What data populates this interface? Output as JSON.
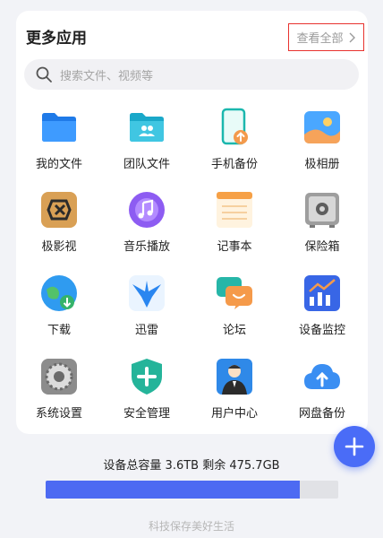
{
  "header": {
    "title": "更多应用",
    "view_all_label": "查看全部"
  },
  "search": {
    "placeholder": "搜索文件、视频等"
  },
  "apps": [
    {
      "label": "我的文件",
      "icon": "folder-icon"
    },
    {
      "label": "团队文件",
      "icon": "team-folder-icon"
    },
    {
      "label": "手机备份",
      "icon": "phone-backup-icon"
    },
    {
      "label": "极相册",
      "icon": "photo-album-icon"
    },
    {
      "label": "极影视",
      "icon": "video-icon"
    },
    {
      "label": "音乐播放",
      "icon": "music-icon"
    },
    {
      "label": "记事本",
      "icon": "notepad-icon"
    },
    {
      "label": "保险箱",
      "icon": "safe-icon"
    },
    {
      "label": "下载",
      "icon": "download-icon"
    },
    {
      "label": "迅雷",
      "icon": "thunder-icon"
    },
    {
      "label": "论坛",
      "icon": "forum-icon"
    },
    {
      "label": "设备监控",
      "icon": "monitor-icon"
    },
    {
      "label": "系统设置",
      "icon": "settings-icon"
    },
    {
      "label": "安全管理",
      "icon": "security-shield-icon"
    },
    {
      "label": "用户中心",
      "icon": "user-center-icon"
    },
    {
      "label": "网盘备份",
      "icon": "cloud-backup-icon"
    }
  ],
  "storage": {
    "text": "设备总容量 3.6TB  剩余 475.7GB",
    "used_fraction": 0.87,
    "bar_color": "#4d6af2"
  },
  "footer": {
    "slogan": "科技保存美好生活"
  },
  "colors": {
    "accent": "#4a6cf7",
    "highlight_border": "#e8322e"
  }
}
